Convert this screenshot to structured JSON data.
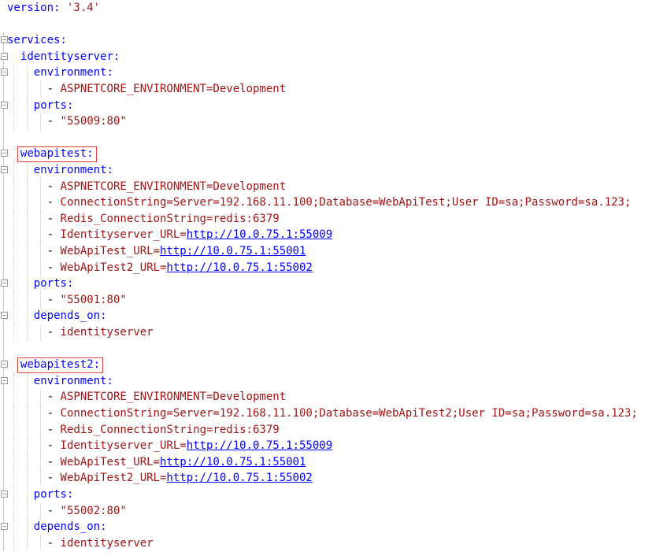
{
  "lines": [
    {
      "fold": false,
      "indent": 0,
      "parts": [
        {
          "t": "key",
          "v": "version: "
        },
        {
          "t": "str",
          "v": "'3.4'"
        }
      ]
    },
    {
      "fold": false,
      "indent": 0,
      "parts": []
    },
    {
      "fold": true,
      "indent": 0,
      "parts": [
        {
          "t": "key",
          "v": "services:"
        }
      ]
    },
    {
      "fold": true,
      "indent": 1,
      "parts": [
        {
          "t": "key",
          "v": "identityserver:"
        }
      ]
    },
    {
      "fold": true,
      "indent": 2,
      "parts": [
        {
          "t": "key",
          "v": "environment:"
        }
      ]
    },
    {
      "fold": false,
      "indent": 3,
      "parts": [
        {
          "t": "dash",
          "v": "- "
        },
        {
          "t": "str",
          "v": "ASPNETCORE_ENVIRONMENT=Development"
        }
      ]
    },
    {
      "fold": true,
      "indent": 2,
      "parts": [
        {
          "t": "key",
          "v": "ports:"
        }
      ]
    },
    {
      "fold": false,
      "indent": 3,
      "parts": [
        {
          "t": "dash",
          "v": "- "
        },
        {
          "t": "str",
          "v": "\"55009:80\""
        }
      ]
    },
    {
      "fold": false,
      "indent": 0,
      "parts": []
    },
    {
      "fold": true,
      "indent": 1,
      "hl": true,
      "parts": [
        {
          "t": "key",
          "v": "webapitest:"
        }
      ]
    },
    {
      "fold": true,
      "indent": 2,
      "parts": [
        {
          "t": "key",
          "v": "environment:"
        }
      ]
    },
    {
      "fold": false,
      "indent": 3,
      "parts": [
        {
          "t": "dash",
          "v": "- "
        },
        {
          "t": "str",
          "v": "ASPNETCORE_ENVIRONMENT=Development"
        }
      ]
    },
    {
      "fold": false,
      "indent": 3,
      "parts": [
        {
          "t": "dash",
          "v": "- "
        },
        {
          "t": "str",
          "v": "ConnectionString=Server=192.168.11.100;Database=WebApiTest;User ID=sa;Password=sa.123;"
        }
      ]
    },
    {
      "fold": false,
      "indent": 3,
      "parts": [
        {
          "t": "dash",
          "v": "- "
        },
        {
          "t": "str",
          "v": "Redis_ConnectionString=redis:6379"
        }
      ]
    },
    {
      "fold": false,
      "indent": 3,
      "parts": [
        {
          "t": "dash",
          "v": "- "
        },
        {
          "t": "str",
          "v": "Identityserver_URL="
        },
        {
          "t": "link",
          "v": "http://10.0.75.1:55009"
        }
      ]
    },
    {
      "fold": false,
      "indent": 3,
      "parts": [
        {
          "t": "dash",
          "v": "- "
        },
        {
          "t": "str",
          "v": "WebApiTest_URL="
        },
        {
          "t": "link",
          "v": "http://10.0.75.1:55001"
        }
      ]
    },
    {
      "fold": false,
      "indent": 3,
      "parts": [
        {
          "t": "dash",
          "v": "- "
        },
        {
          "t": "str",
          "v": "WebApiTest2_URL="
        },
        {
          "t": "link",
          "v": "http://10.0.75.1:55002"
        }
      ]
    },
    {
      "fold": true,
      "indent": 2,
      "parts": [
        {
          "t": "key",
          "v": "ports:"
        }
      ]
    },
    {
      "fold": false,
      "indent": 3,
      "parts": [
        {
          "t": "dash",
          "v": "- "
        },
        {
          "t": "str",
          "v": "\"55001:80\""
        }
      ]
    },
    {
      "fold": true,
      "indent": 2,
      "parts": [
        {
          "t": "key",
          "v": "depends_on:"
        }
      ]
    },
    {
      "fold": false,
      "indent": 3,
      "parts": [
        {
          "t": "dash",
          "v": "- "
        },
        {
          "t": "str",
          "v": "identityserver"
        }
      ]
    },
    {
      "fold": false,
      "indent": 0,
      "parts": []
    },
    {
      "fold": true,
      "indent": 1,
      "hl": true,
      "parts": [
        {
          "t": "key",
          "v": "webapitest2:"
        }
      ]
    },
    {
      "fold": true,
      "indent": 2,
      "parts": [
        {
          "t": "key",
          "v": "environment:"
        }
      ]
    },
    {
      "fold": false,
      "indent": 3,
      "parts": [
        {
          "t": "dash",
          "v": "- "
        },
        {
          "t": "str",
          "v": "ASPNETCORE_ENVIRONMENT=Development"
        }
      ]
    },
    {
      "fold": false,
      "indent": 3,
      "parts": [
        {
          "t": "dash",
          "v": "- "
        },
        {
          "t": "str",
          "v": "ConnectionString=Server=192.168.11.100;Database=WebApiTest2;User ID=sa;Password=sa.123;"
        }
      ]
    },
    {
      "fold": false,
      "indent": 3,
      "parts": [
        {
          "t": "dash",
          "v": "- "
        },
        {
          "t": "str",
          "v": "Redis_ConnectionString=redis:6379"
        }
      ]
    },
    {
      "fold": false,
      "indent": 3,
      "parts": [
        {
          "t": "dash",
          "v": "- "
        },
        {
          "t": "str",
          "v": "Identityserver_URL="
        },
        {
          "t": "link",
          "v": "http://10.0.75.1:55009"
        }
      ]
    },
    {
      "fold": false,
      "indent": 3,
      "parts": [
        {
          "t": "dash",
          "v": "- "
        },
        {
          "t": "str",
          "v": "WebApiTest_URL="
        },
        {
          "t": "link",
          "v": "http://10.0.75.1:55001"
        }
      ]
    },
    {
      "fold": false,
      "indent": 3,
      "parts": [
        {
          "t": "dash",
          "v": "- "
        },
        {
          "t": "str",
          "v": "WebApiTest2_URL="
        },
        {
          "t": "link",
          "v": "http://10.0.75.1:55002"
        }
      ]
    },
    {
      "fold": true,
      "indent": 2,
      "parts": [
        {
          "t": "key",
          "v": "ports:"
        }
      ]
    },
    {
      "fold": false,
      "indent": 3,
      "parts": [
        {
          "t": "dash",
          "v": "- "
        },
        {
          "t": "str",
          "v": "\"55002:80\""
        }
      ]
    },
    {
      "fold": true,
      "indent": 2,
      "parts": [
        {
          "t": "key",
          "v": "depends_on:"
        }
      ]
    },
    {
      "fold": false,
      "indent": 3,
      "parts": [
        {
          "t": "dash",
          "v": "- "
        },
        {
          "t": "str",
          "v": "identityserver"
        }
      ]
    }
  ],
  "colors": {
    "key": "#0000ff",
    "str": "#a31515",
    "link": "#0000ff",
    "highlight": "#e0423a"
  }
}
